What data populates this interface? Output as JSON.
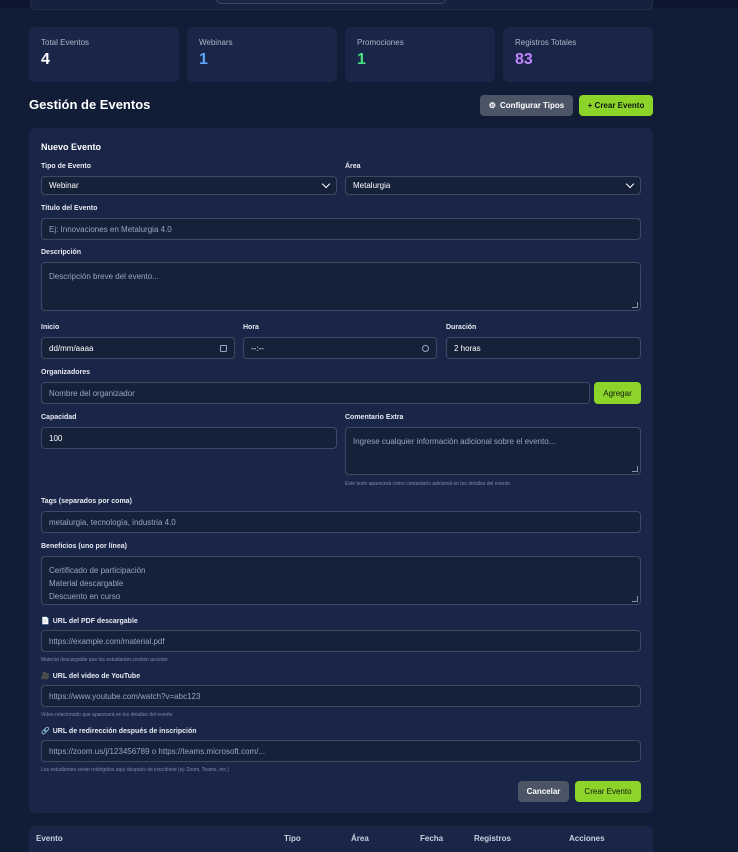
{
  "stats": [
    {
      "label": "Total Eventos",
      "value": "4",
      "color": "#ffffff"
    },
    {
      "label": "Webinars",
      "value": "1",
      "color": "#60a5fa"
    },
    {
      "label": "Promociones",
      "value": "1",
      "color": "#4ade80"
    },
    {
      "label": "Registros Totales",
      "value": "83",
      "color": "#c084fc"
    }
  ],
  "header": {
    "title": "Gestión de Eventos",
    "configure_label": "Configurar Tipos",
    "configure_icon": "gear-icon",
    "create_label": "+ Crear Evento"
  },
  "form": {
    "title": "Nuevo Evento",
    "type_label": "Tipo de Evento",
    "type_value": "Webinar",
    "area_label": "Área",
    "area_value": "Metalurgia",
    "event_title_label": "Título del Evento",
    "event_title_placeholder": "Ej: Innovaciones en Metalurgia 4.0",
    "description_label": "Descripción",
    "description_placeholder": "Descripción breve del evento...",
    "start_label": "Inicio",
    "start_value": "dd/mm/aaaa",
    "time_label": "Hora",
    "time_value": "--:--",
    "duration_label": "Duración",
    "duration_value": "2 horas",
    "organizers_label": "Organizadores",
    "organizers_placeholder": "Nombre del organizador",
    "add_label": "Agregar",
    "capacity_label": "Capacidad",
    "capacity_value": "100",
    "comment_label": "Comentario Extra",
    "comment_placeholder": "Ingrese cualquier información adicional sobre el evento...",
    "comment_hint": "Este texto aparecerá como comentario adicional en los detalles del evento",
    "tags_label": "Tags (separados por coma)",
    "tags_placeholder": "metalurgia, tecnología, industria 4.0",
    "benefits_label": "Beneficios (uno por línea)",
    "benefits_lines": [
      "Certificado de participación",
      "Material descargable",
      "Descuento en curso"
    ],
    "pdf_label": "URL del PDF descargable",
    "pdf_icon": "📄",
    "pdf_placeholder": "https://example.com/material.pdf",
    "pdf_hint": "Material descargable que los estudiantes podrán acceder",
    "video_label": "URL del video de YouTube",
    "video_icon": "🎥",
    "video_placeholder": "https://www.youtube.com/watch?v=abc123",
    "video_hint": "Video relacionado que aparecerá en los detalles del evento",
    "redirect_label": "URL de redirección después de inscripción",
    "redirect_icon": "🔗",
    "redirect_placeholder": "https://zoom.us/j/123456789 o https://teams.microsoft.com/...",
    "redirect_hint": "Los estudiantes serán redirigidos aquí después de inscribirse (ej: Zoom, Teams, etc.)",
    "cancel_label": "Cancelar",
    "submit_label": "Crear Evento"
  },
  "table": {
    "columns": [
      "Evento",
      "Tipo",
      "Área",
      "Fecha",
      "Registros",
      "Acciones"
    ]
  }
}
